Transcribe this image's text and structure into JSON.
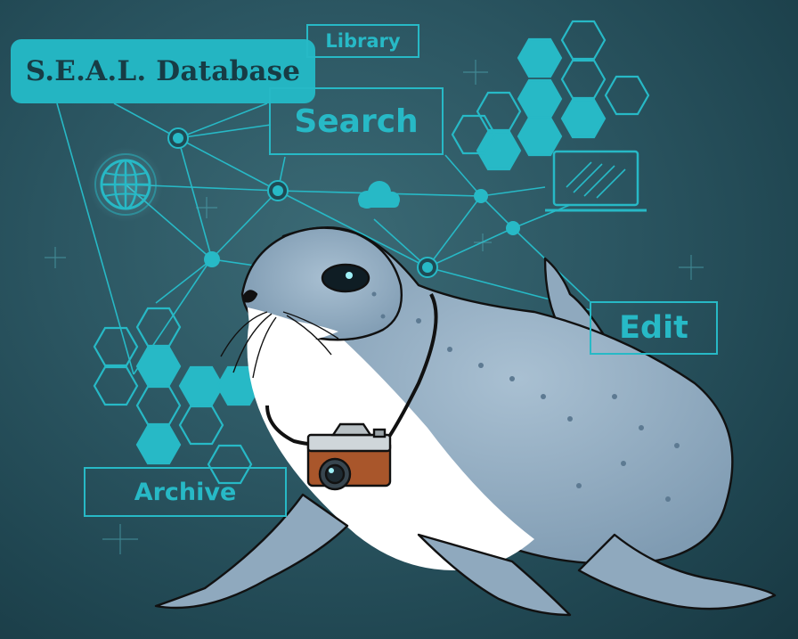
{
  "labels": {
    "title": "S.E.A.L. Database",
    "library": "Library",
    "search": "Search",
    "edit": "Edit",
    "archive": "Archive"
  },
  "colors": {
    "background": "#2c5763",
    "accent": "#27b9c6",
    "title_text": "#173c45",
    "seal_body": "#9ab2c6",
    "seal_belly": "#ffffff",
    "camera": "#a9562b"
  },
  "icons": [
    "globe-icon",
    "cloud-icon",
    "laptop-icon",
    "camera-icon"
  ]
}
